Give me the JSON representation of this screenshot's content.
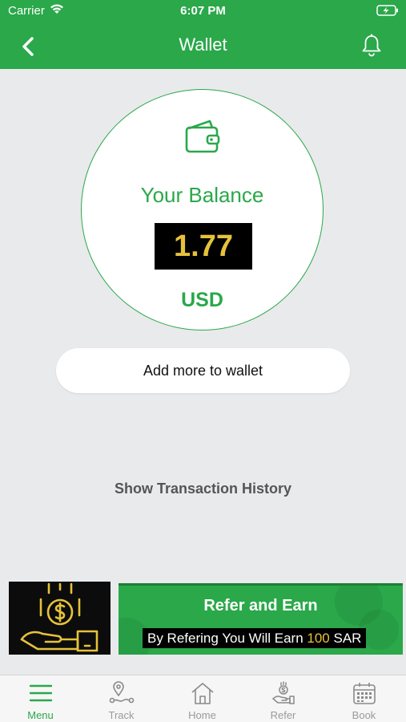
{
  "status_bar": {
    "carrier": "Carrier",
    "time": "6:07 PM"
  },
  "header": {
    "title": "Wallet",
    "back_icon": "chevron-left-icon",
    "notification_icon": "bell-icon"
  },
  "balance": {
    "label": "Your Balance",
    "amount": "1.77",
    "currency": "USD",
    "icon": "wallet-icon"
  },
  "actions": {
    "add_label": "Add more to wallet",
    "history_label": "Show Transaction History"
  },
  "refer": {
    "title": "Refer and Earn",
    "text_before": "By Refering You Will Earn ",
    "amount": "100",
    "text_after": " SAR"
  },
  "tabs": [
    {
      "label": "Menu",
      "icon": "menu-icon",
      "active": true
    },
    {
      "label": "Track",
      "icon": "track-icon",
      "active": false
    },
    {
      "label": "Home",
      "icon": "home-icon",
      "active": false
    },
    {
      "label": "Refer",
      "icon": "refer-icon",
      "active": false
    },
    {
      "label": "Book",
      "icon": "calendar-icon",
      "active": false
    }
  ],
  "colors": {
    "brand_green": "#2aa84a",
    "gold": "#e6c23a",
    "background": "#e9eaec"
  }
}
